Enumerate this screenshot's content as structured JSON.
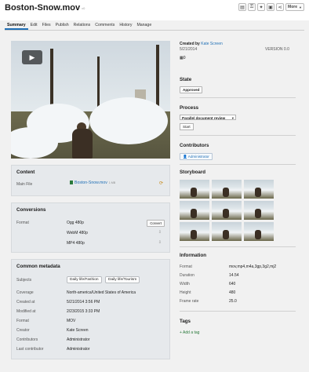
{
  "header": {
    "title": "Boston-Snow.mov",
    "version_small": "v0",
    "more_label": "More"
  },
  "tabs": [
    {
      "label": "Summary"
    },
    {
      "label": "Edit"
    },
    {
      "label": "Files"
    },
    {
      "label": "Publish"
    },
    {
      "label": "Relations"
    },
    {
      "label": "Comments"
    },
    {
      "label": "History"
    },
    {
      "label": "Manage"
    }
  ],
  "video": {
    "play_icon": "play-icon"
  },
  "content": {
    "title": "Content",
    "main_file_label": "Main File",
    "main_file_name": "Boston-Snow.mov",
    "main_file_size": "1 MB"
  },
  "conversions": {
    "title": "Conversions",
    "format_label": "Format",
    "items": [
      {
        "name": "Ogg 480p",
        "action": "Convert"
      },
      {
        "name": "WebM 480p"
      },
      {
        "name": "MP4 480p"
      }
    ]
  },
  "metadata": {
    "title": "Common metadata",
    "subjects_label": "Subjects",
    "subjects": [
      "Daily life/Fashion",
      "Daily life/Tourism"
    ],
    "rows": [
      {
        "label": "Coverage",
        "value": "North-america/United States of America"
      },
      {
        "label": "Created at",
        "value": "5/21/2014 3:56 PM"
      },
      {
        "label": "Modified at",
        "value": "2/23/2015 3:33 PM"
      },
      {
        "label": "Format",
        "value": "MOV"
      },
      {
        "label": "Creator",
        "value": "Kate Screen"
      },
      {
        "label": "Contributors",
        "value": "Administrator"
      },
      {
        "label": "Last contributor",
        "value": "Administrator"
      }
    ]
  },
  "side": {
    "created_by_label": "Created by",
    "created_by": "Kate Screen",
    "date": "5/21/2014",
    "version": "VERSION 0.0",
    "views_count": "0",
    "state_title": "State",
    "state_value": "Approved",
    "process_title": "Process",
    "process_value": "Parallel document review",
    "start_label": "Start",
    "contributors_title": "Contributors",
    "contributor": "Administrator",
    "storyboard_title": "Storyboard",
    "information_title": "Information",
    "info": [
      {
        "label": "Format",
        "value": "mov,mp4,m4a,3gp,3g2,mj2"
      },
      {
        "label": "Duration",
        "value": "14.54"
      },
      {
        "label": "Width",
        "value": "640"
      },
      {
        "label": "Height",
        "value": "480"
      },
      {
        "label": "Frame rate",
        "value": "25.0"
      }
    ],
    "tags_title": "Tags",
    "add_tag": "Add a tag"
  },
  "colors": {
    "accent": "#1f6fb5",
    "green": "#2b7a3c"
  }
}
